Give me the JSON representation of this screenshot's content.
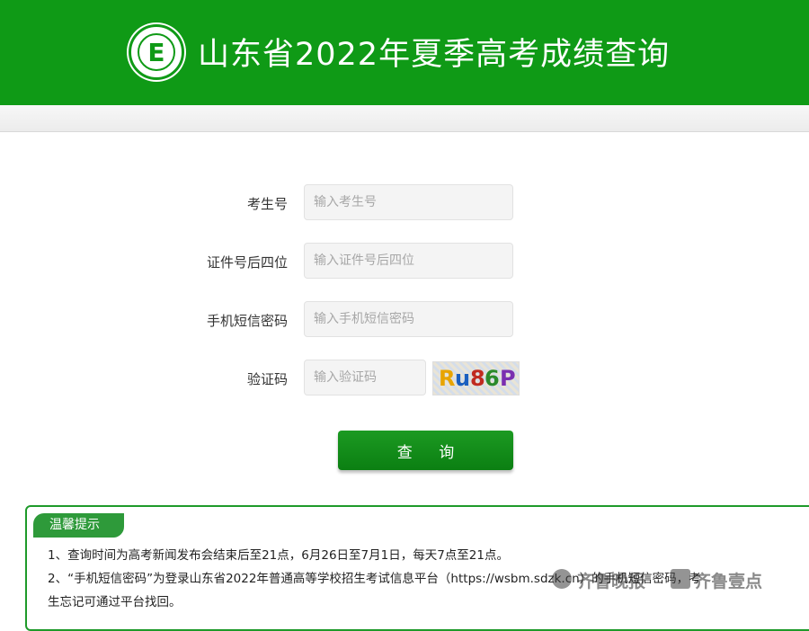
{
  "header": {
    "title": "山东省2022年夏季高考成绩查询",
    "logo_letter": "E",
    "brand_color": "#0f9a16"
  },
  "form": {
    "fields": [
      {
        "label": "考生号",
        "placeholder": "输入考生号"
      },
      {
        "label": "证件号后四位",
        "placeholder": "输入证件号后四位"
      },
      {
        "label": "手机短信密码",
        "placeholder": "输入手机短信密码"
      },
      {
        "label": "验证码",
        "placeholder": "输入验证码"
      }
    ],
    "captcha": [
      "R",
      "u",
      "8",
      "6",
      "P"
    ],
    "captcha_colors": [
      "#e8a400",
      "#1a5fbf",
      "#c02a1f",
      "#2b8a2b",
      "#7a2fb0"
    ],
    "submit_label": "查 询"
  },
  "tips": {
    "title": "温馨提示",
    "lines": [
      "1、查询时间为高考新闻发布会结束后至21点，6月26日至7月1日，每天7点至21点。",
      "2、“手机短信密码”为登录山东省2022年普通高等学校招生考试信息平台（https://wsbm.sdzk.cn）的手机短信密码，考",
      "生忘记可通过平台找回。"
    ]
  },
  "watermark": {
    "text1": "齐鲁晚报",
    "text2": "齐鲁壹点"
  }
}
